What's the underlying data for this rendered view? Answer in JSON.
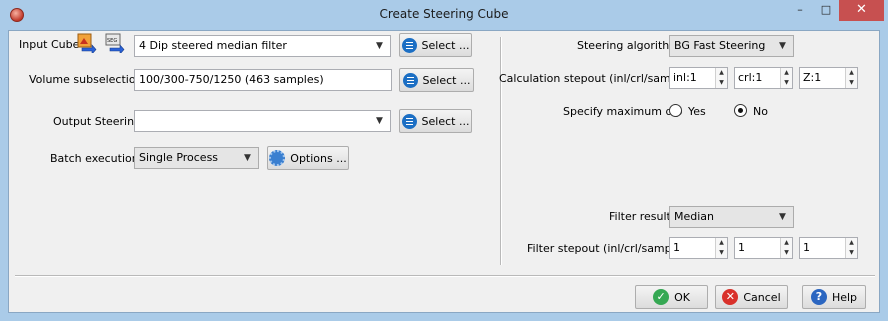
{
  "window": {
    "title": "Create Steering Cube",
    "min_glyph": "–",
    "max_glyph": "□",
    "close_glyph": "✕"
  },
  "input": {
    "label": "Input Cube",
    "value": "4 Dip steered median filter",
    "select_label": "Select ..."
  },
  "volume": {
    "label": "Volume subselection",
    "value": "100/300-750/1250 (463 samples)",
    "select_label": "Select ..."
  },
  "output": {
    "label": "Output Steering",
    "value": "",
    "select_label": "Select ..."
  },
  "batch": {
    "label": "Batch execution",
    "value": "Single Process",
    "options_label": "Options ..."
  },
  "steering": {
    "label": "Steering algorithm",
    "value": "BG Fast Steering"
  },
  "stepout": {
    "label": "Calculation stepout (inl/crl/sample)",
    "inl": "inl:1",
    "crl": "crl:1",
    "z": "Z:1"
  },
  "maxdip": {
    "label": "Specify maximum dip",
    "yes": "Yes",
    "no": "No",
    "selected": "No"
  },
  "filter": {
    "label": "Filter result",
    "value": "Median"
  },
  "filter_stepout": {
    "label": "Filter stepout (inl/crl/sample)",
    "inl": "1",
    "crl": "1",
    "z": "1"
  },
  "buttons": {
    "ok": "OK",
    "cancel": "Cancel",
    "help": "Help"
  },
  "colors": {
    "frame": "#aacbe8",
    "close_button": "#c75050",
    "dialog_bg": "#f0f0f0"
  }
}
